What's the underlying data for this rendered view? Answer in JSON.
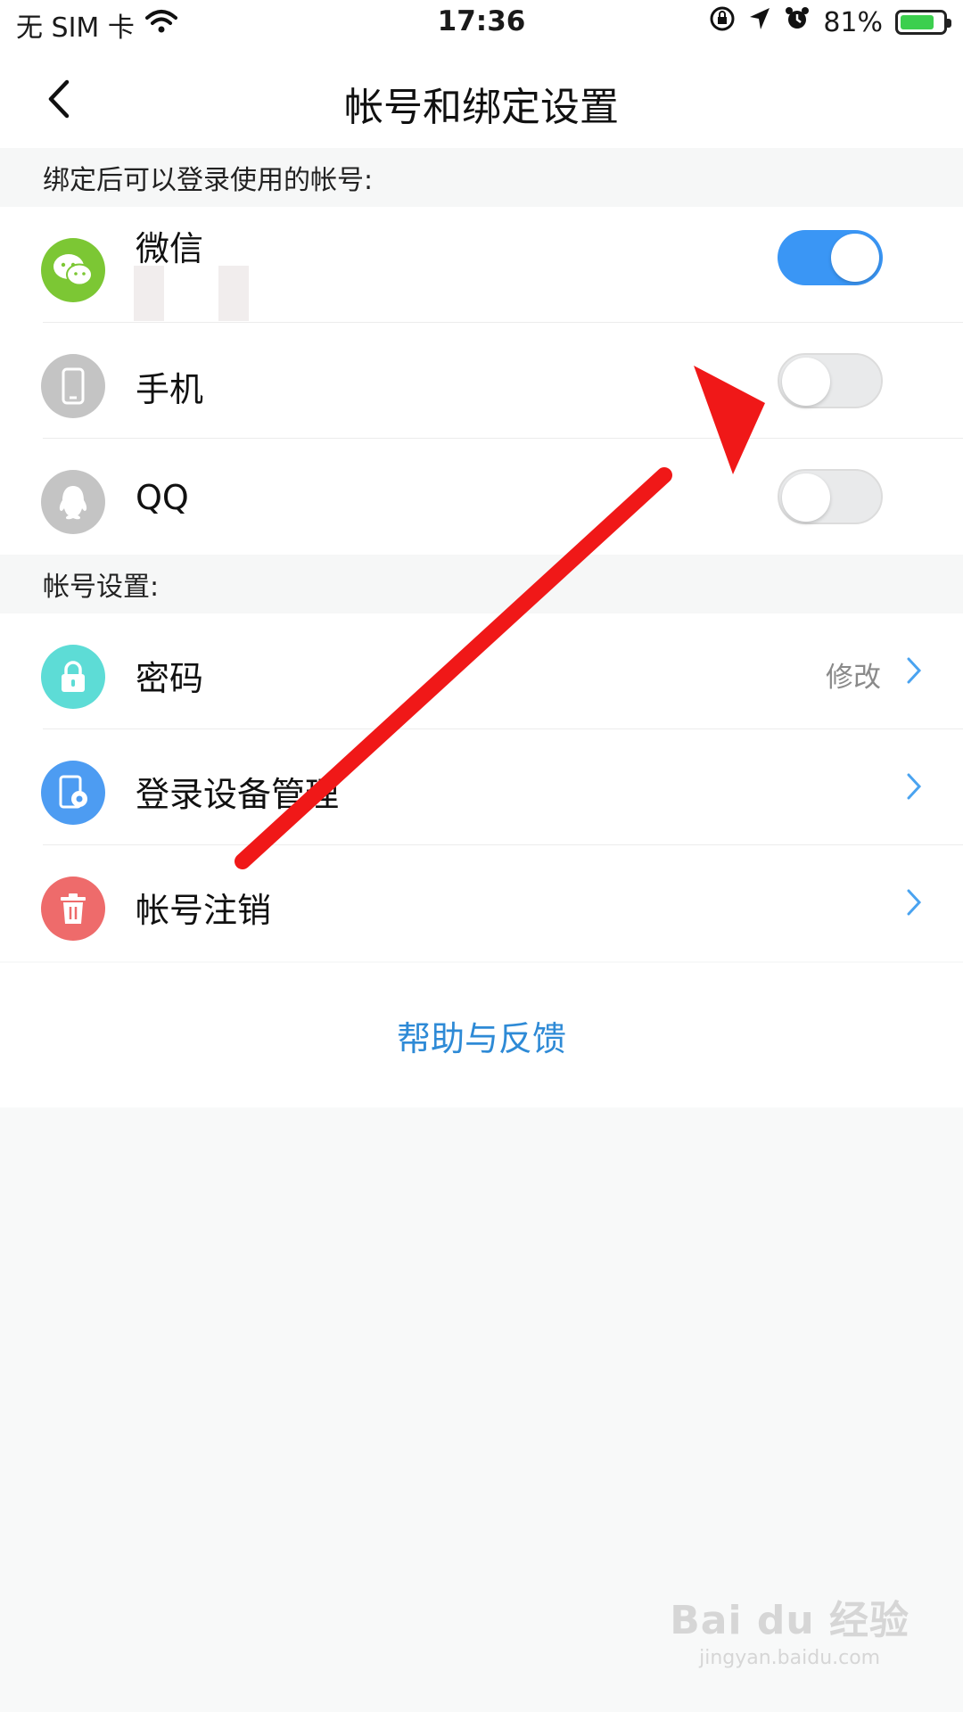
{
  "status_bar": {
    "carrier": "无 SIM 卡",
    "time": "17:36",
    "battery_percent": "81%",
    "battery_level": 0.81,
    "icons": [
      "wifi-icon",
      "rotation-lock-icon",
      "location-icon",
      "alarm-icon",
      "battery-charging-icon"
    ]
  },
  "nav": {
    "back_icon": "chevron-left-icon",
    "title": "帐号和绑定设置"
  },
  "bind_section": {
    "header": "绑定后可以登录使用的帐号:",
    "items": [
      {
        "label": "微信",
        "icon": "wechat-icon",
        "icon_color": "#7cc734",
        "toggle_on": true
      },
      {
        "label": "手机",
        "icon": "phone-icon",
        "icon_color": "#c4c4c4",
        "toggle_on": false
      },
      {
        "label": "QQ",
        "icon": "qq-icon",
        "icon_color": "#c4c4c4",
        "toggle_on": false
      }
    ]
  },
  "account_section": {
    "header": "帐号设置:",
    "items": [
      {
        "label": "密码",
        "icon": "lock-icon",
        "icon_color": "#5ddcd6",
        "value": "修改"
      },
      {
        "label": "登录设备管理",
        "icon": "device-settings-icon",
        "icon_color": "#4d9cf2",
        "value": ""
      },
      {
        "label": "帐号注销",
        "icon": "trash-icon",
        "icon_color": "#ee6b6b",
        "value": ""
      }
    ]
  },
  "help": {
    "label": "帮助与反馈"
  },
  "watermark": {
    "logo": "Bai du 经验",
    "url": "jingyan.baidu.com"
  },
  "colors": {
    "accent": "#3a96f5",
    "link": "#2e8ad6",
    "annotation_arrow": "#f01818"
  }
}
